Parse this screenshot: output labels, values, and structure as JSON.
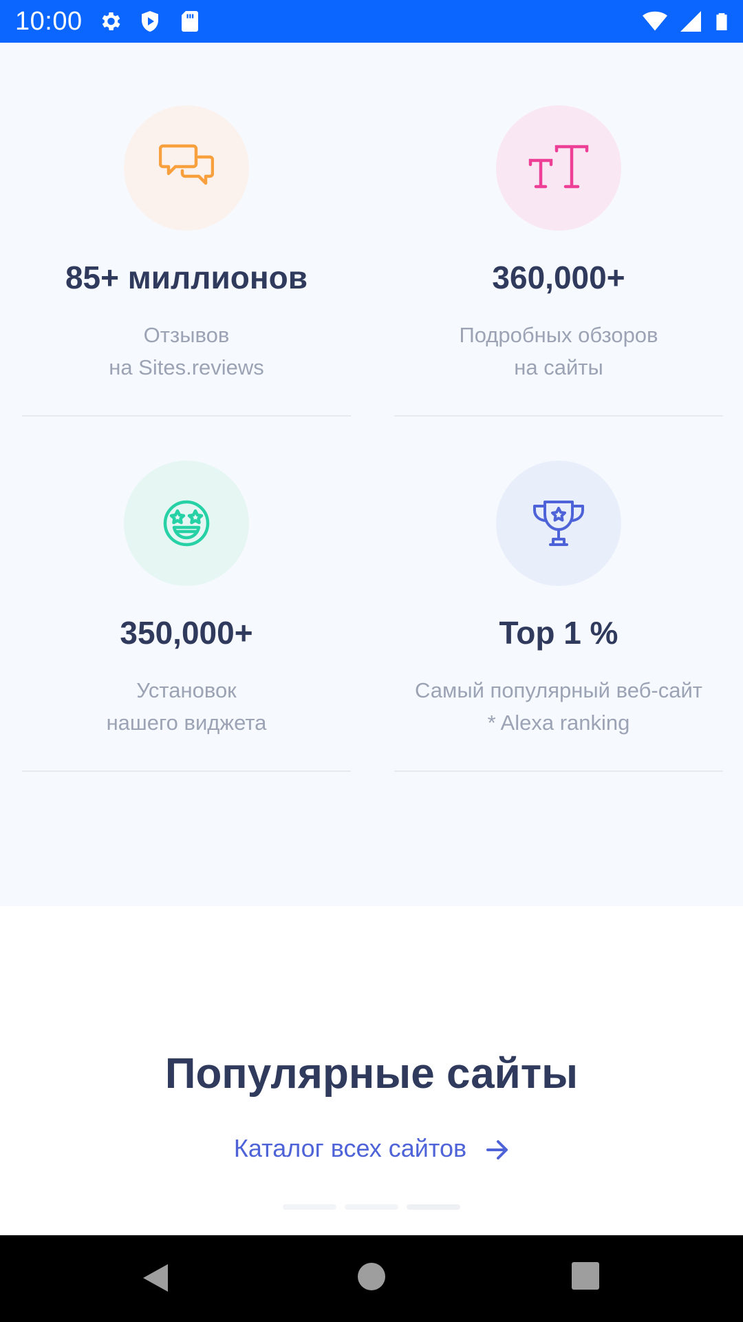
{
  "status_bar": {
    "time": "10:00",
    "left_icons": [
      "settings-icon",
      "shield-icon",
      "sd-card-icon"
    ],
    "right_icons": [
      "wifi-icon",
      "signal-icon",
      "battery-icon"
    ]
  },
  "stats": [
    {
      "icon": "chat-bubbles-icon",
      "value": "85+ миллионов",
      "desc_line1": "Отзывов",
      "desc_line2": "на Sites.reviews",
      "icon_bg": "#fbf2ee",
      "icon_color": "#f7a03d"
    },
    {
      "icon": "text-size-icon",
      "value": "360,000+",
      "desc_line1": "Подробных обзоров",
      "desc_line2": "на сайты",
      "icon_bg": "#f9e8f4",
      "icon_color": "#ee3f97"
    },
    {
      "icon": "star-eyes-emoji-icon",
      "value": "350,000+",
      "desc_line1": "Установок",
      "desc_line2": "нашего виджета",
      "icon_bg": "#e6f6f3",
      "icon_color": "#27d1a6"
    },
    {
      "icon": "trophy-icon",
      "value": "Top 1 %",
      "desc_line1": "Самый популярный веб-сайт",
      "desc_line2": "* Alexa ranking",
      "icon_bg": "#e9eefb",
      "icon_color": "#4e63d7"
    }
  ],
  "popular": {
    "title": "Популярные сайты",
    "catalog_link": "Каталог всех сайтов"
  },
  "colors": {
    "status_bar": "#0a66ff",
    "heading": "#2f3a5c",
    "muted": "#9ca3b4",
    "accent": "#4e63d7"
  },
  "nav": {
    "buttons": [
      "back-icon",
      "home-icon",
      "recents-icon"
    ]
  }
}
